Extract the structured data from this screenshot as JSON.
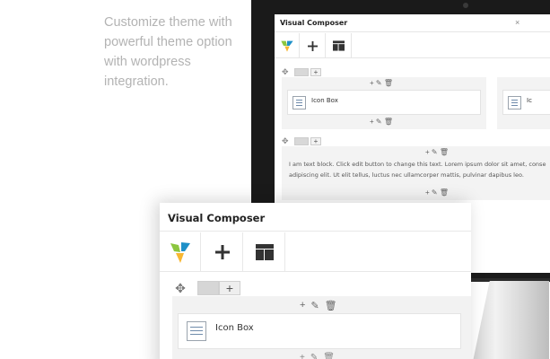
{
  "tagline": {
    "lines": [
      "Customize theme with",
      "powerful theme option",
      "with wordpress",
      "integration."
    ]
  },
  "back_screen": {
    "title": "Visual Composer",
    "close": "×",
    "row_add": "+",
    "element_actions": "+ ✎ 🗑",
    "icon_box_label": "Icon Box",
    "icon_box_label_partial": "Ic",
    "text_block_lines": [
      "I am text block. Click edit button to change this text. Lorem ipsum dolor sit amet, conse",
      "adipiscing elit. Ut elit tellus, luctus nec ullamcorper mattis, pulvinar dapibus leo."
    ]
  },
  "front_panel": {
    "title": "Visual Composer",
    "toolbar": {
      "logo_icon": "visual-composer-logo",
      "add_icon": "+",
      "layout_icon": "layout-icon"
    },
    "row_controls": {
      "move_icon": "✥",
      "add_label": "+"
    },
    "element_actions": {
      "add": "+",
      "edit": "✎",
      "delete": "🗑"
    },
    "icon_box_label": "Icon Box"
  },
  "colors": {
    "tagline": "#b3b3b3",
    "monitor_bezel": "#1a1a1a",
    "panel_bg": "#f2f2f2",
    "logo_green": "#8cc63f",
    "logo_blue": "#1e90c8",
    "logo_yellow": "#f7b731"
  }
}
